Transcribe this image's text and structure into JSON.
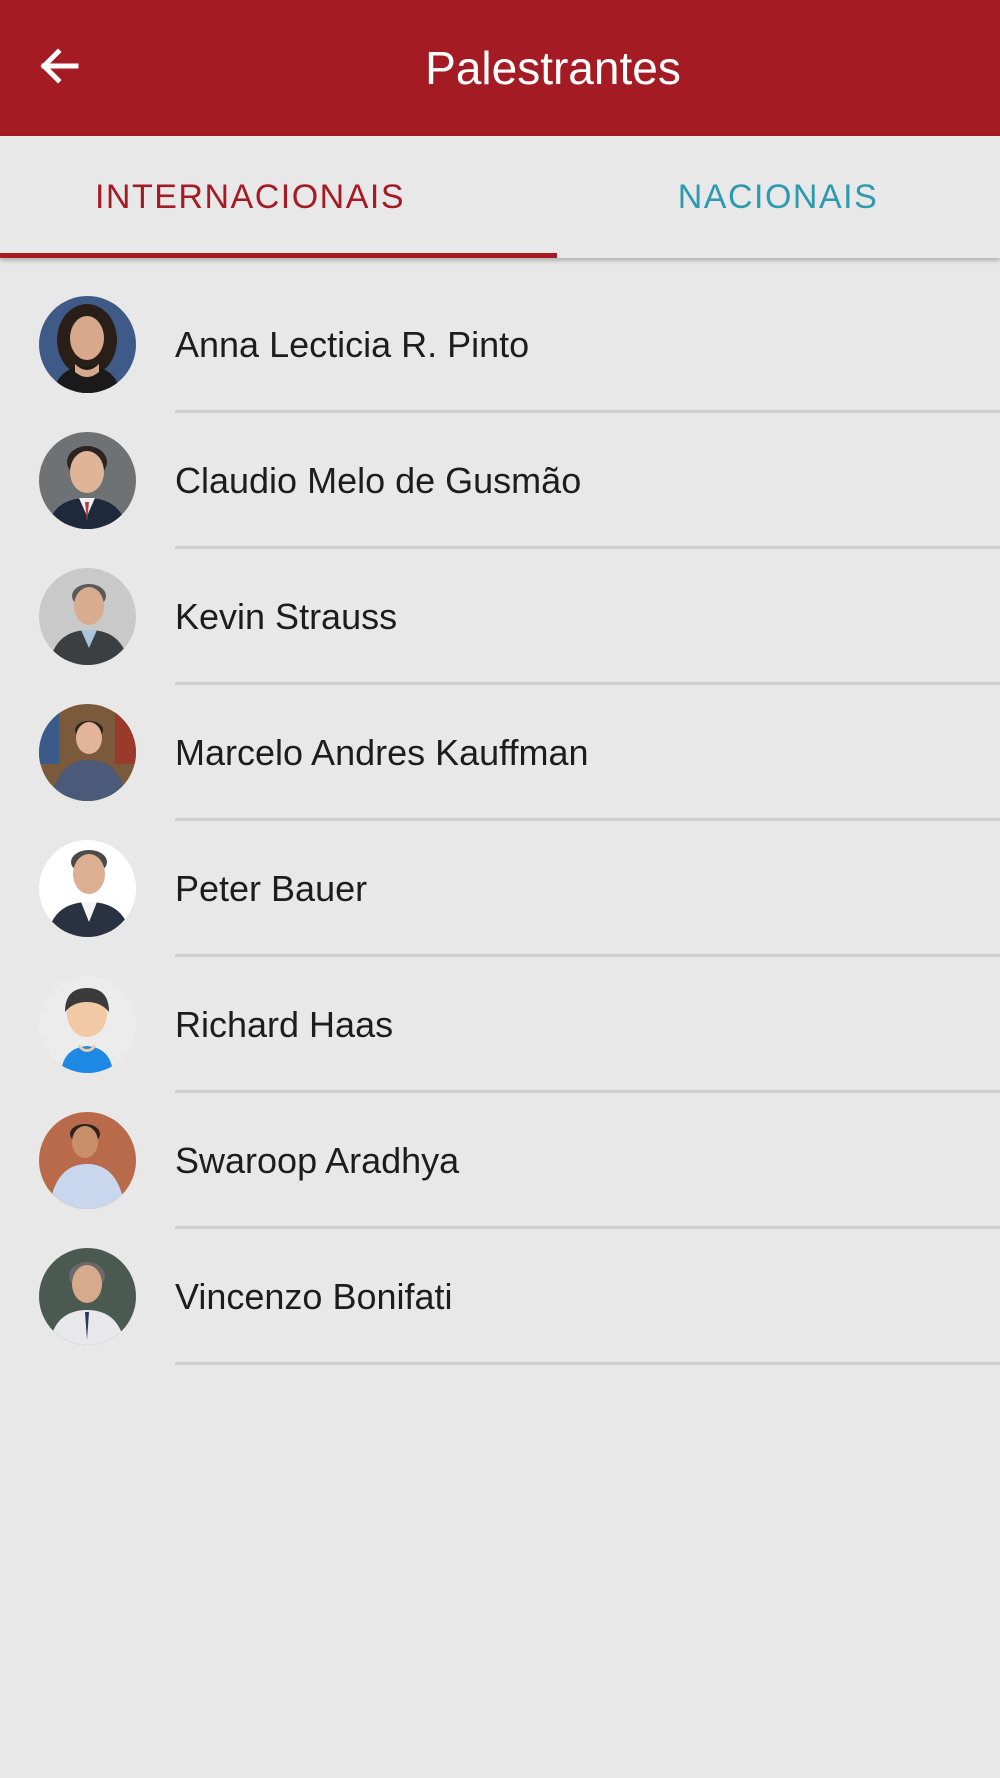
{
  "colors": {
    "appbar": "#a51b24",
    "active_tab": "#a51b24",
    "inactive_tab": "#2e9ab0",
    "indicator": "#a51b24"
  },
  "header": {
    "title": "Palestrantes",
    "back_icon": "arrow-left-icon"
  },
  "tabs": [
    {
      "label": "INTERNACIONAIS",
      "selected": true
    },
    {
      "label": "NACIONAIS",
      "selected": false
    }
  ],
  "speakers": [
    {
      "name": "Anna Lecticia R. Pinto",
      "avatar": "photo"
    },
    {
      "name": "Claudio Melo de Gusmão",
      "avatar": "photo"
    },
    {
      "name": "Kevin Strauss",
      "avatar": "photo"
    },
    {
      "name": "Marcelo Andres Kauffman",
      "avatar": "photo"
    },
    {
      "name": "Peter Bauer",
      "avatar": "photo"
    },
    {
      "name": "Richard Haas",
      "avatar": "default-user-icon"
    },
    {
      "name": "Swaroop Aradhya",
      "avatar": "photo"
    },
    {
      "name": "Vincenzo Bonifati",
      "avatar": "photo"
    }
  ]
}
